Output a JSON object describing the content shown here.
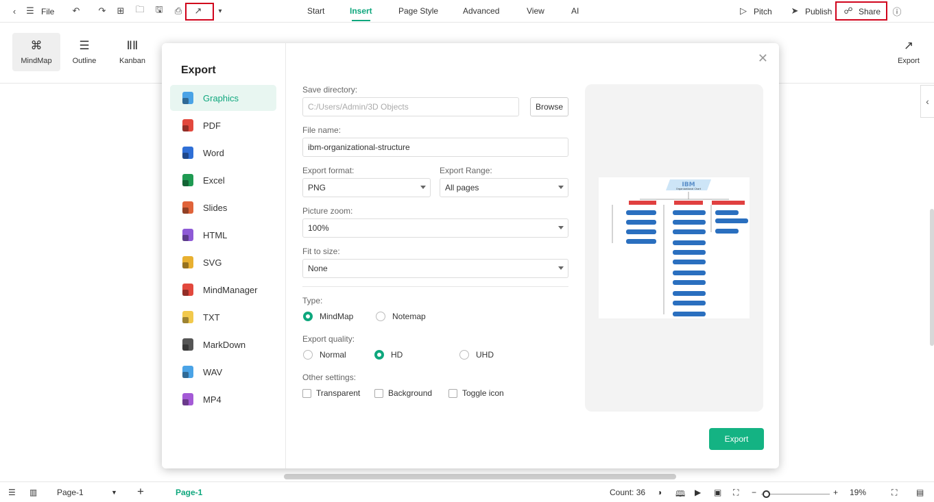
{
  "topbar": {
    "file_label": "File",
    "tabs": [
      "Start",
      "Insert",
      "Page Style",
      "Advanced",
      "View",
      "AI"
    ],
    "active_tab": "Insert",
    "pitch_label": "Pitch",
    "publish_label": "Publish",
    "share_label": "Share"
  },
  "toolbar2": {
    "views": [
      {
        "label": "MindMap",
        "icon": "mindmap-icon"
      },
      {
        "label": "Outline",
        "icon": "outline-icon"
      },
      {
        "label": "Kanban",
        "icon": "kanban-icon"
      }
    ],
    "export_label": "Export"
  },
  "dialog": {
    "title": "Export",
    "formats": [
      {
        "label": "Graphics",
        "color": "#4aa3e6",
        "active": true
      },
      {
        "label": "PDF",
        "color": "#e2483d"
      },
      {
        "label": "Word",
        "color": "#2f6fd6"
      },
      {
        "label": "Excel",
        "color": "#1f9a52"
      },
      {
        "label": "Slides",
        "color": "#e0633a"
      },
      {
        "label": "HTML",
        "color": "#8e5ad6"
      },
      {
        "label": "SVG",
        "color": "#e8b030"
      },
      {
        "label": "MindManager",
        "color": "#e2483d"
      },
      {
        "label": "TXT",
        "color": "#f2c94c"
      },
      {
        "label": "MarkDown",
        "color": "#555555"
      },
      {
        "label": "WAV",
        "color": "#4aa3e6"
      },
      {
        "label": "MP4",
        "color": "#a45ad6"
      }
    ],
    "save_directory_label": "Save directory:",
    "save_directory_value": "C:/Users/Admin/3D Objects",
    "browse_label": "Browse",
    "file_name_label": "File name:",
    "file_name_value": "ibm-organizational-structure",
    "export_format_label": "Export format:",
    "export_format_value": "PNG",
    "export_range_label": "Export Range:",
    "export_range_value": "All pages",
    "picture_zoom_label": "Picture zoom:",
    "picture_zoom_value": "100%",
    "fit_to_size_label": "Fit to size:",
    "fit_to_size_value": "None",
    "type_label": "Type:",
    "type_options": [
      "MindMap",
      "Notemap"
    ],
    "type_selected": "MindMap",
    "quality_label": "Export quality:",
    "quality_options": [
      "Normal",
      "HD",
      "UHD"
    ],
    "quality_selected": "HD",
    "other_label": "Other settings:",
    "other_options": [
      "Transparent",
      "Background",
      "Toggle icon"
    ],
    "export_button": "Export",
    "preview": {
      "title": "IBM",
      "subtitle": "Organizational Chart"
    }
  },
  "bottombar": {
    "page_select": "Page-1",
    "page_tab": "Page-1",
    "count": "Count: 36",
    "zoom": "19%"
  },
  "colors": {
    "accent": "#0ea77d",
    "highlight": "#d0021b"
  }
}
